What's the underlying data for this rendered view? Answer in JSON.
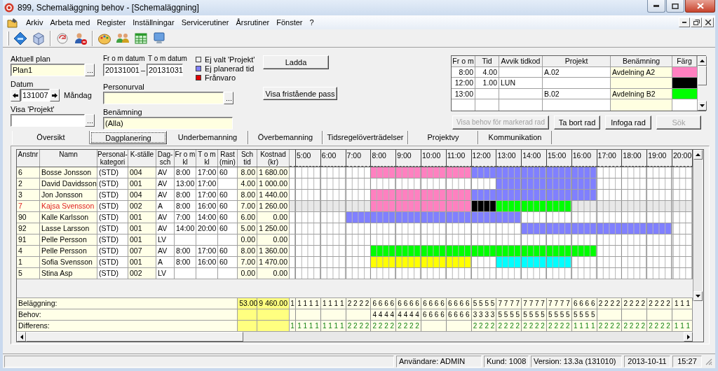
{
  "window": {
    "title": "899, Schemaläggning behov - [Schemaläggning]"
  },
  "menu": [
    "Arkiv",
    "Arbeta med",
    "Register",
    "Inställningar",
    "Servicerutiner",
    "Årsrutiner",
    "Fönster",
    "?"
  ],
  "form": {
    "plan": {
      "label": "Aktuell plan",
      "value": "Plan1"
    },
    "from_date": {
      "label": "Fr o m datum",
      "value": "20131001"
    },
    "date_separator": "–",
    "to_date": {
      "label": "T o m datum",
      "value": "20131031"
    },
    "legend": [
      {
        "label": "Ej valt 'Projekt'",
        "color": "#f0f0f0"
      },
      {
        "label": "Ej planerad tid",
        "color": "#8080ff"
      },
      {
        "label": "Frånvaro",
        "color": "#e00000"
      }
    ],
    "date": {
      "label": "Datum",
      "value": "131007",
      "weekday": "Måndag"
    },
    "person_selection": {
      "label": "Personurval"
    },
    "project": {
      "label": "Visa 'Projekt'"
    },
    "description": {
      "label": "Benämning",
      "value": "(Alla)"
    }
  },
  "actions": [
    {
      "label": "Ladda"
    },
    {
      "label": "Visa fristående pass"
    }
  ],
  "periods": {
    "columns": [
      "Fr o m",
      "Tid",
      "Avvik tidkod",
      "Projekt",
      "Benämning",
      "Färg"
    ],
    "rows": [
      {
        "from": "8:00",
        "time": "4.00",
        "project": "A.02",
        "name": "Avdelning A2",
        "color": "#ff80c0"
      },
      {
        "from": "12:00",
        "time": "1.00",
        "code": "LUN",
        "color": "#000000"
      },
      {
        "from": "13:00",
        "project": "B.02",
        "name": "Avdelning B2",
        "color": "#00ff00"
      }
    ]
  },
  "period_buttons": [
    {
      "label": "Visa behov för markerad rad",
      "disabled": true
    },
    {
      "label": "Ta bort rad",
      "disabled": false
    },
    {
      "label": "Infoga rad",
      "disabled": false
    },
    {
      "label": "Sök",
      "disabled": true
    }
  ],
  "tabs": [
    {
      "label": "Översikt",
      "selected": false
    },
    {
      "label": "Dagplanering",
      "selected": true
    },
    {
      "label": "Underbemanning",
      "selected": false
    },
    {
      "label": "Överbemanning",
      "selected": false
    },
    {
      "label": "Tidsregelöverträdelser",
      "selected": false
    },
    {
      "label": "Projektvy",
      "selected": false
    },
    {
      "label": "Kommunikation",
      "selected": false
    }
  ],
  "schedule": {
    "columns": [
      "Anstnr",
      "Namn",
      "Personal-\nkategori",
      "K-ställe",
      "Dag-\nsch",
      "Fr o m\nkl",
      "T o m\nkl",
      "Rast\n(min)",
      "Sch\ntid",
      "Kostnad\n(kr)"
    ],
    "hours": [
      {
        "occupancy": "1",
        "difference": "1"
      },
      {
        "label": "5:00",
        "occupancy": "1 1 1 1",
        "difference": "1 1 1 1"
      },
      {
        "label": "6:00",
        "occupancy": "1 1 1 1",
        "difference": "1 1 1 1"
      },
      {
        "label": "7:00",
        "occupancy": "2 2 2 2",
        "difference": "2 2 2 2"
      },
      {
        "label": "8:00",
        "occupancy": "6 6 6 6",
        "need": "4 4 4 4",
        "difference": "2 2 2 2"
      },
      {
        "label": "9:00",
        "occupancy": "6 6 6 6",
        "need": "4 4 4 4",
        "difference": "2 2 2 2"
      },
      {
        "label": "10:00",
        "occupancy": "6 6 6 6",
        "need": "6 6 6 6"
      },
      {
        "label": "11:00",
        "occupancy": "6 6 6 6",
        "need": "6 6 6 6"
      },
      {
        "label": "12:00",
        "occupancy": "5 5 5 5",
        "need": "3 3 3 3",
        "difference": "2 2 2 2"
      },
      {
        "label": "13:00",
        "occupancy": "7 7 7 7",
        "need": "5 5 5 5",
        "difference": "2 2 2 2"
      },
      {
        "label": "14:00",
        "occupancy": "7 7 7 7",
        "need": "5 5 5 5",
        "difference": "2 2 2 2"
      },
      {
        "label": "15:00",
        "occupancy": "7 7 7 7",
        "need": "5 5 5 5",
        "difference": "2 2 2 2"
      },
      {
        "label": "16:00",
        "occupancy": "6 6 6 6",
        "need": "5 5 5 5",
        "difference": "1 1 1 1"
      },
      {
        "label": "17:00",
        "occupancy": "2 2 2 2",
        "difference": "2 2 2 2"
      },
      {
        "label": "18:00",
        "occupancy": "2 2 2 2",
        "difference": "2 2 2 2"
      },
      {
        "label": "19:00",
        "occupancy": "2 2 2 2",
        "difference": "2 2 2 2"
      },
      {
        "label": "20:00",
        "occupancy": "1 1 1",
        "difference": "1 1 1"
      }
    ],
    "rows": [
      {
        "selected": false,
        "cells": [
          "6",
          "Bosse Jonsson",
          "(STD)",
          "004",
          "AV",
          "8:00",
          "17:00",
          "60",
          "8.00",
          "1 680.00"
        ],
        "slots": [
          {
            "color": "#ffffff"
          },
          {
            "color": "#ffffff"
          },
          {
            "color": "#ffffff"
          },
          {
            "color": "#ffffff"
          },
          {
            "color": "#ff80c0"
          },
          {
            "color": "#ff80c0"
          },
          {
            "color": "#ff80c0"
          },
          {
            "color": "#ff80c0"
          },
          {
            "color": "#8080ff"
          },
          {
            "color": "#8080ff"
          },
          {
            "color": "#8080ff"
          },
          {
            "color": "#8080ff"
          },
          {
            "color": "#8080ff"
          },
          {
            "color": "#ffffff"
          },
          {
            "color": "#ffffff"
          },
          {
            "color": "#ffffff"
          },
          {
            "color": "#ffffff"
          }
        ]
      },
      {
        "selected": false,
        "cells": [
          "2",
          "David Davidsson",
          "(STD)",
          "001",
          "AV",
          "13:00",
          "17:00",
          null,
          "4.00",
          "1 000.00"
        ],
        "slots": [
          {
            "color": "#ffffff"
          },
          {
            "color": "#ffffff"
          },
          {
            "color": "#ffffff"
          },
          {
            "color": "#ffffff"
          },
          {
            "color": "#ffffff"
          },
          {
            "color": "#ffffff"
          },
          {
            "color": "#ffffff"
          },
          {
            "color": "#ffffff"
          },
          {
            "color": "#ffffff"
          },
          {
            "color": "#8080ff"
          },
          {
            "color": "#8080ff"
          },
          {
            "color": "#8080ff"
          },
          {
            "color": "#8080ff"
          },
          {
            "color": "#ffffff"
          },
          {
            "color": "#ffffff"
          },
          {
            "color": "#ffffff"
          },
          {
            "color": "#ffffff"
          }
        ]
      },
      {
        "selected": false,
        "cells": [
          "3",
          "Jon Jonsson",
          "(STD)",
          "004",
          "AV",
          "8:00",
          "17:00",
          "60",
          "8.00",
          "1 440.00"
        ],
        "slots": [
          {
            "color": "#ffffff"
          },
          {
            "color": "#ffffff"
          },
          {
            "color": "#ffffff"
          },
          {
            "color": "#ffffff"
          },
          {
            "color": "#ff80c0"
          },
          {
            "color": "#ff80c0"
          },
          {
            "color": "#ff80c0"
          },
          {
            "color": "#ff80c0"
          },
          {
            "color": "#8080ff"
          },
          {
            "color": "#8080ff"
          },
          {
            "color": "#8080ff"
          },
          {
            "color": "#8080ff"
          },
          {
            "color": "#8080ff"
          },
          {
            "color": "#ffffff"
          },
          {
            "color": "#ffffff"
          },
          {
            "color": "#ffffff"
          },
          {
            "color": "#ffffff"
          }
        ]
      },
      {
        "selected": true,
        "cells": [
          "7",
          "Kajsa Svensson",
          "(STD)",
          "002",
          "A",
          "8:00",
          "16:00",
          "60",
          "7.00",
          "1 260.00"
        ],
        "slots": [
          {
            "color": "#e8e8e8"
          },
          {
            "color": "#e8e8e8"
          },
          {
            "color": "#e8e8e8"
          },
          {
            "color": "#e8e8e8"
          },
          {
            "color": "#ff80c0"
          },
          {
            "color": "#ff80c0"
          },
          {
            "color": "#ff80c0"
          },
          {
            "color": "#ff80c0"
          },
          {
            "color": "#000000"
          },
          {
            "color": "#00ff00"
          },
          {
            "color": "#00ff00"
          },
          {
            "color": "#00ff00"
          },
          {
            "color": "#e8e8e8"
          },
          {
            "color": "#e8e8e8"
          },
          {
            "color": "#e8e8e8"
          },
          {
            "color": "#e8e8e8"
          },
          {
            "color": "#e8e8e8"
          }
        ]
      },
      {
        "selected": false,
        "cells": [
          "90",
          "Kalle Karlsson",
          "(STD)",
          "001",
          "AV",
          "7:00",
          "14:00",
          "60",
          "6.00",
          "0.00"
        ],
        "slots": [
          {
            "color": "#ffffff"
          },
          {
            "color": "#ffffff"
          },
          {
            "color": "#ffffff"
          },
          {
            "color": "#8080ff"
          },
          {
            "color": "#8080ff"
          },
          {
            "color": "#8080ff"
          },
          {
            "color": "#8080ff"
          },
          {
            "color": "#8080ff"
          },
          {
            "color": "#8080ff"
          },
          {
            "color": "#8080ff"
          },
          {
            "color": "#ffffff"
          },
          {
            "color": "#ffffff"
          },
          {
            "color": "#ffffff"
          },
          {
            "color": "#ffffff"
          },
          {
            "color": "#ffffff"
          },
          {
            "color": "#ffffff"
          },
          {
            "color": "#ffffff"
          }
        ]
      },
      {
        "selected": false,
        "cells": [
          "92",
          "Lasse Larsson",
          "(STD)",
          "001",
          "AV",
          "14:00",
          "20:00",
          "60",
          "5.00",
          "1 250.00"
        ],
        "slots": [
          {
            "color": "#ffffff"
          },
          {
            "color": "#ffffff"
          },
          {
            "color": "#ffffff"
          },
          {
            "color": "#ffffff"
          },
          {
            "color": "#ffffff"
          },
          {
            "color": "#ffffff"
          },
          {
            "color": "#ffffff"
          },
          {
            "color": "#ffffff"
          },
          {
            "color": "#ffffff"
          },
          {
            "color": "#ffffff"
          },
          {
            "color": "#8080ff"
          },
          {
            "color": "#8080ff"
          },
          {
            "color": "#8080ff"
          },
          {
            "color": "#8080ff"
          },
          {
            "color": "#8080ff"
          },
          {
            "color": "#8080ff"
          },
          {
            "color": "#ffffff"
          }
        ]
      },
      {
        "selected": false,
        "cells": [
          "91",
          "Pelle Persson",
          "(STD)",
          "001",
          "LV",
          null,
          null,
          null,
          "0.00",
          "0.00"
        ],
        "slots": [
          {
            "color": "#ffffff"
          },
          {
            "color": "#ffffff"
          },
          {
            "color": "#ffffff"
          },
          {
            "color": "#ffffff"
          },
          {
            "color": "#ffffff"
          },
          {
            "color": "#ffffff"
          },
          {
            "color": "#ffffff"
          },
          {
            "color": "#ffffff"
          },
          {
            "color": "#ffffff"
          },
          {
            "color": "#ffffff"
          },
          {
            "color": "#ffffff"
          },
          {
            "color": "#ffffff"
          },
          {
            "color": "#ffffff"
          },
          {
            "color": "#ffffff"
          },
          {
            "color": "#ffffff"
          },
          {
            "color": "#ffffff"
          },
          {
            "color": "#ffffff"
          }
        ]
      },
      {
        "selected": false,
        "cells": [
          "4",
          "Pelle Persson",
          "(STD)",
          "007",
          "AV",
          "8:00",
          "17:00",
          "60",
          "8.00",
          "1 360.00"
        ],
        "slots": [
          {
            "color": "#ffffff"
          },
          {
            "color": "#ffffff"
          },
          {
            "color": "#ffffff"
          },
          {
            "color": "#ffffff"
          },
          {
            "color": "#00ff00"
          },
          {
            "color": "#00ff00"
          },
          {
            "color": "#00ff00"
          },
          {
            "color": "#00ff00"
          },
          {
            "color": "#00ff00"
          },
          {
            "color": "#00ff00"
          },
          {
            "color": "#00ff00"
          },
          {
            "color": "#00ff00"
          },
          {
            "color": "#00ff00"
          },
          {
            "color": "#ffffff"
          },
          {
            "color": "#ffffff"
          },
          {
            "color": "#ffffff"
          },
          {
            "color": "#ffffff"
          }
        ]
      },
      {
        "selected": false,
        "cells": [
          "1",
          "Sofia Svensson",
          "(STD)",
          "001",
          "A",
          "8:00",
          "16:00",
          "60",
          "7.00",
          "1 470.00"
        ],
        "slots": [
          {
            "color": "#ffffff"
          },
          {
            "color": "#ffffff"
          },
          {
            "color": "#ffffff"
          },
          {
            "color": "#ffffff"
          },
          {
            "color": "#ffff00"
          },
          {
            "color": "#ffff00"
          },
          {
            "color": "#ffff00"
          },
          {
            "color": "#ffff00"
          },
          {
            "color": "#ffffff"
          },
          {
            "color": "#00ffff"
          },
          {
            "color": "#00ffff"
          },
          {
            "color": "#00ffff"
          },
          {
            "color": "#ffffff"
          },
          {
            "color": "#ffffff"
          },
          {
            "color": "#ffffff"
          },
          {
            "color": "#ffffff"
          },
          {
            "color": "#ffffff"
          }
        ]
      },
      {
        "selected": false,
        "cells": [
          "5",
          "Stina Asp",
          "(STD)",
          "002",
          "LV",
          null,
          null,
          null,
          "0.00",
          "0.00"
        ],
        "slots": [
          {
            "color": "#ffffff"
          },
          {
            "color": "#ffffff"
          },
          {
            "color": "#ffffff"
          },
          {
            "color": "#ffffff"
          },
          {
            "color": "#ffffff"
          },
          {
            "color": "#ffffff"
          },
          {
            "color": "#ffffff"
          },
          {
            "color": "#ffffff"
          },
          {
            "color": "#ffffff"
          },
          {
            "color": "#ffffff"
          },
          {
            "color": "#ffffff"
          },
          {
            "color": "#ffffff"
          },
          {
            "color": "#ffffff"
          },
          {
            "color": "#ffffff"
          },
          {
            "color": "#ffffff"
          },
          {
            "color": "#ffffff"
          },
          {
            "color": "#ffffff"
          }
        ]
      }
    ],
    "totals": [
      {
        "kind": "occupancy",
        "label": "Beläggning:",
        "hours": "53.00",
        "cost": "9 460.00"
      },
      {
        "kind": "need",
        "label": "Behov:"
      },
      {
        "kind": "difference",
        "label": "Differens:"
      }
    ]
  },
  "status_bar": [
    "Användare: ADMIN",
    "Kund: 1008",
    "Version: 13.3a (131010)",
    "2013-10-11",
    "15:27"
  ]
}
